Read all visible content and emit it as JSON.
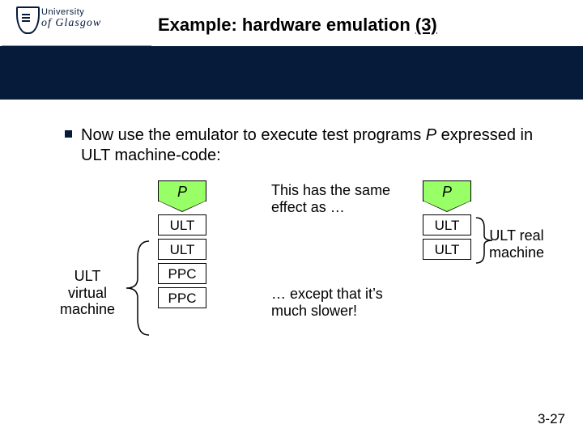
{
  "logo": {
    "line1": "University",
    "line2": "of Glasgow"
  },
  "title": {
    "pre": "Example: hardware emulation ",
    "num": "(3)"
  },
  "bullet": {
    "lead": "Now use the emulator to execute test programs ",
    "P": "P",
    "mid": " expressed in ",
    "ult": "ULT",
    "tail": " machine-code:"
  },
  "diagram": {
    "labels": {
      "virtual": "ULT\nvirtual\nmachine",
      "real": "ULT real\nmachine"
    },
    "leftStack": {
      "P": "P",
      "b1": "ULT",
      "b2": "ULT",
      "b3": "PPC",
      "b4": "PPC"
    },
    "rightStack": {
      "P": "P",
      "b1": "ULT",
      "b2": "ULT"
    },
    "notes": {
      "top": "This has the same effect as …",
      "bot": "… except that it’s much slower!"
    }
  },
  "pageNumber": "3-27"
}
